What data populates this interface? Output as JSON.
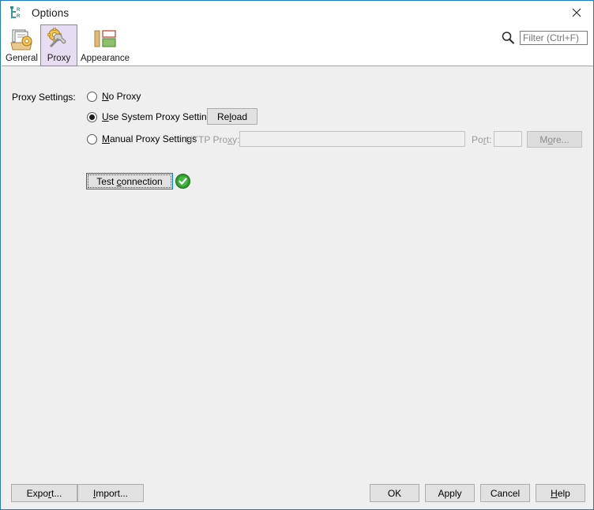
{
  "window": {
    "title": "Options",
    "title_icon": "tree-structure-icon",
    "close_icon": "close-icon",
    "accent_border_color": "#1e7bc0"
  },
  "toolbar": {
    "tabs": [
      {
        "label": "General",
        "icon": "documents-gear-icon",
        "selected": false
      },
      {
        "label": "Proxy",
        "icon": "gear-wrench-icon",
        "selected": true
      },
      {
        "label": "Appearance",
        "icon": "layout-color-icon",
        "selected": false
      }
    ],
    "selected_tab_bg": "#e6ddf2",
    "selected_tab_border": "#9a79c4",
    "search": {
      "icon": "search-icon",
      "value": "",
      "placeholder": "Filter (Ctrl+F)"
    }
  },
  "main": {
    "section_label": "Proxy Settings:",
    "options": [
      {
        "label_pre": "",
        "mnemonic": "N",
        "label_post": "o Proxy",
        "checked": false,
        "name": "no-proxy"
      },
      {
        "label_pre": "",
        "mnemonic": "U",
        "label_post": "se System Proxy Settings",
        "checked": true,
        "name": "use-system-proxy"
      },
      {
        "label_pre": "",
        "mnemonic": "M",
        "label_post": "anual Proxy Settings",
        "checked": false,
        "name": "manual-proxy"
      }
    ],
    "reload_button": {
      "pre": "Re",
      "mnemonic": "l",
      "post": "oad",
      "enabled": true
    },
    "http_proxy": {
      "label_pre": "HTTP Pro",
      "label_mnemonic": "x",
      "label_post": "y:",
      "value": "",
      "placeholder": "",
      "enabled": false
    },
    "port": {
      "label_pre": "Po",
      "label_mnemonic": "r",
      "label_post": "t:",
      "value": "",
      "placeholder": "",
      "enabled": false
    },
    "more_button": {
      "pre": "M",
      "mnemonic": "o",
      "post": "re...",
      "enabled": false
    },
    "test_connection": {
      "pre": "Test ",
      "mnemonic": "c",
      "post": "onnection",
      "focused": true,
      "focus_border_color": "#0078d7"
    },
    "status": {
      "icon": "success-check-icon",
      "color": "#2f9e2f",
      "state": "ok"
    }
  },
  "footer": {
    "export_button": {
      "pre": "Expo",
      "mnemonic": "r",
      "post": "t..."
    },
    "import_button": {
      "pre": "",
      "mnemonic": "I",
      "post": "mport..."
    },
    "ok_button": "OK",
    "apply_button": "Apply",
    "cancel_button": "Cancel",
    "help_button": {
      "pre": "",
      "mnemonic": "H",
      "post": "elp"
    }
  }
}
